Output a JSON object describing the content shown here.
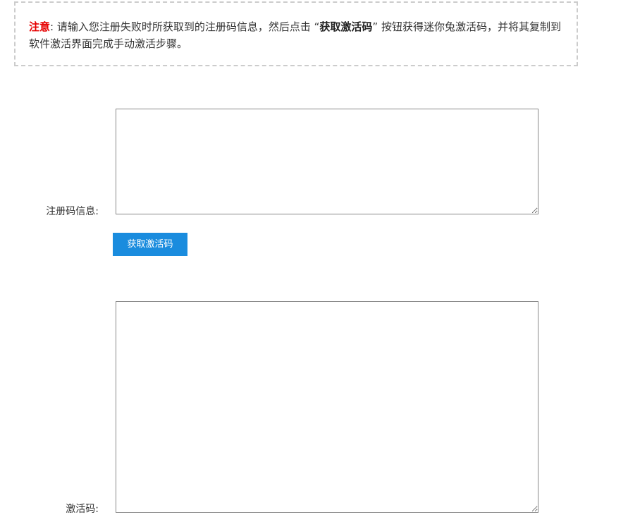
{
  "notice": {
    "label": "注意",
    "text_before": ": 请输入您注册失败时所获取到的注册码信息，然后点击 “",
    "strong": "获取激活码",
    "text_after": "” 按钮获得迷你兔激活码，并将其复制到软件激活界面完成手动激活步骤。"
  },
  "form": {
    "registration_label": "注册码信息:",
    "registration_value": "",
    "get_code_button": "获取激活码",
    "activation_label": "激活码:",
    "activation_value": ""
  },
  "colors": {
    "notice_label": "#e60000",
    "button_bg": "#1a8cde",
    "border_dashed": "#cccccc"
  }
}
